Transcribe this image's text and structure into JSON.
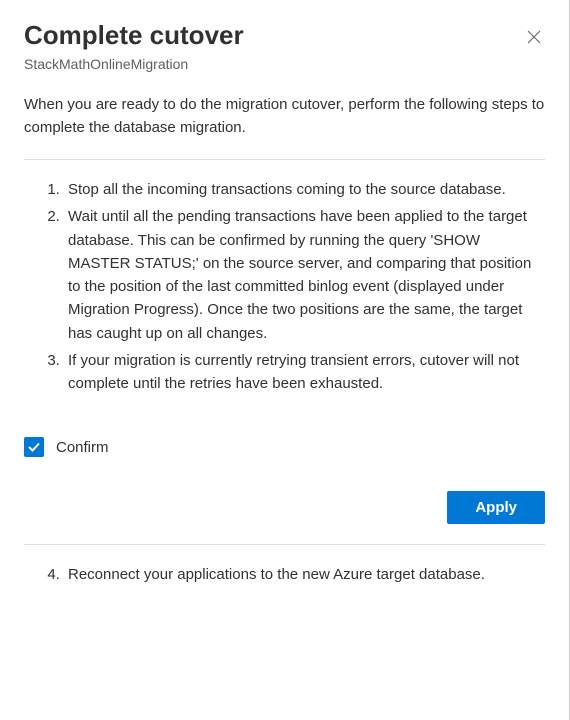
{
  "header": {
    "title": "Complete cutover",
    "subtitle": "StackMathOnlineMigration"
  },
  "intro": "When you are ready to do the migration cutover, perform the following steps to complete the database migration.",
  "steps": {
    "s1": "Stop all the incoming transactions coming to the source database.",
    "s2": "Wait until all the pending transactions have been applied to the target database. This can be confirmed by running the query 'SHOW MASTER STATUS;' on the source server, and comparing that position to the position of the last committed binlog event (displayed under Migration Progress). Once the two positions are the same, the target has caught up on all changes.",
    "s3": "If your migration is currently retrying transient errors, cutover will not complete until the retries have been exhausted.",
    "s4": "Reconnect your applications to the new Azure target database."
  },
  "confirm": {
    "label": "Confirm",
    "checked": true
  },
  "buttons": {
    "apply": "Apply"
  }
}
